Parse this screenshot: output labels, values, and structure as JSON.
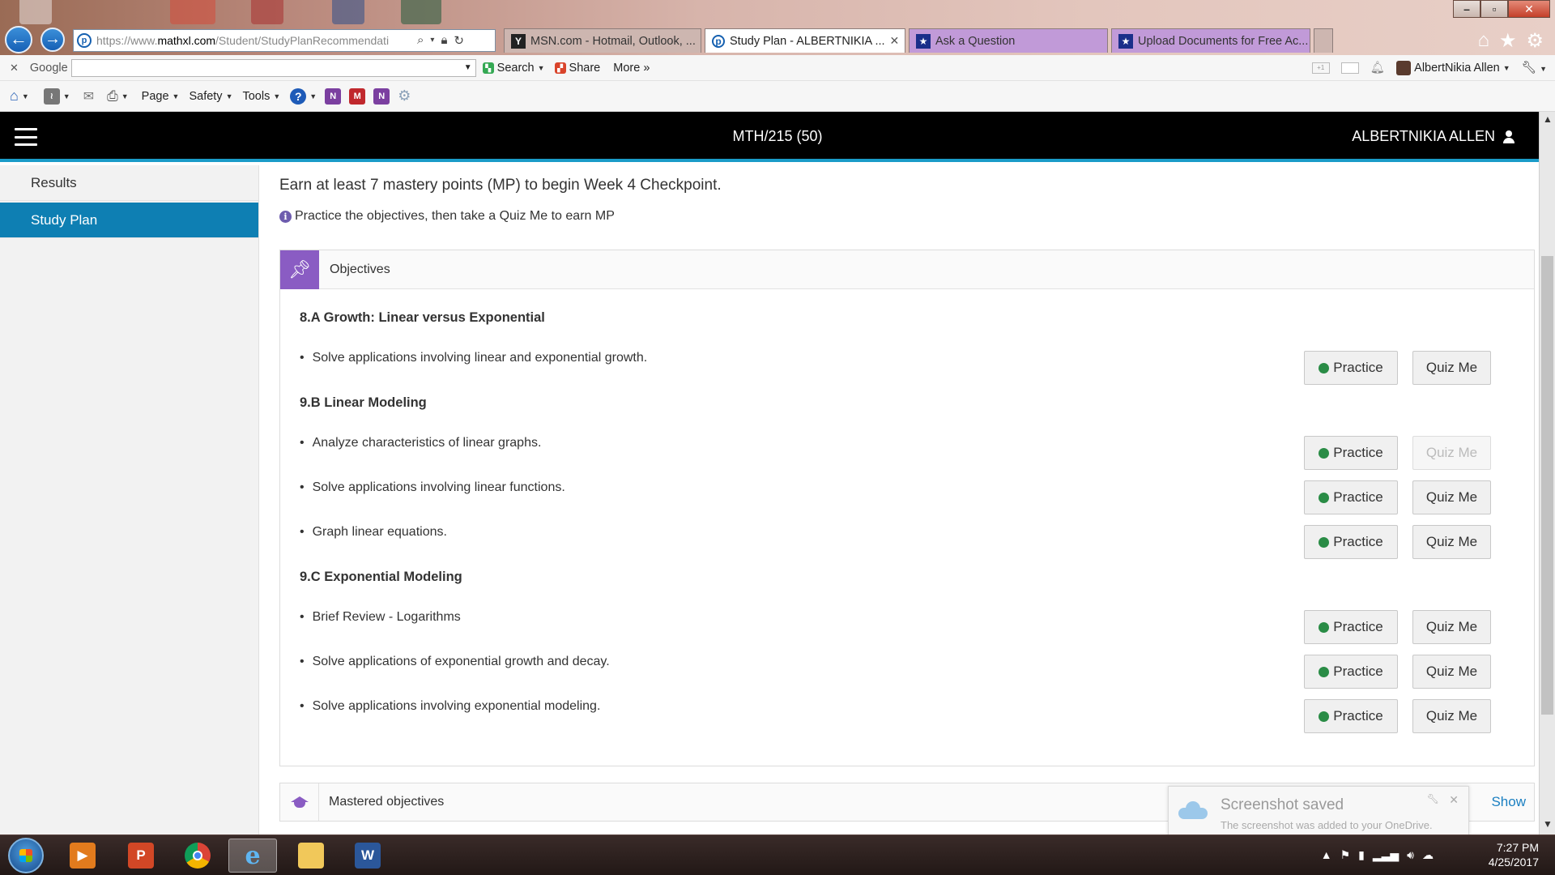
{
  "browser": {
    "url_prefix": "https://www.",
    "url_domain": "mathxl.com",
    "url_path": "/Student/StudyPlanRecommendati",
    "tabs": [
      {
        "label": "MSN.com - Hotmail, Outlook, ...",
        "active": false
      },
      {
        "label": "Study Plan - ALBERTNIKIA ...",
        "active": true
      },
      {
        "label": "Ask a Question",
        "active": false
      },
      {
        "label": "Upload Documents for Free Ac...",
        "active": false
      }
    ],
    "google_label": "Google",
    "search_label": "Search",
    "share_label": "Share",
    "more_label": "More »",
    "account_label": "AlbertNikia Allen",
    "command_bar": {
      "page": "Page",
      "safety": "Safety",
      "tools": "Tools"
    }
  },
  "header": {
    "course": "MTH/215 (50)",
    "user": "ALBERTNIKIA ALLEN"
  },
  "sidebar": {
    "items": [
      {
        "label": "Results",
        "active": false
      },
      {
        "label": "Study Plan",
        "active": true
      }
    ]
  },
  "main": {
    "instruction": "Earn at least 7 mastery points (MP) to begin Week 4 Checkpoint.",
    "hint": "Practice the objectives, then take a Quiz Me to earn MP",
    "objectives_title": "Objectives",
    "sections": [
      {
        "title": "8.A Growth: Linear versus Exponential",
        "objectives": [
          {
            "text": "Solve applications involving linear and exponential growth.",
            "practice": "Practice",
            "quiz": "Quiz Me",
            "quiz_enabled": true
          }
        ]
      },
      {
        "title": "9.B Linear Modeling",
        "objectives": [
          {
            "text": "Analyze characteristics of linear graphs.",
            "practice": "Practice",
            "quiz": "Quiz Me",
            "quiz_enabled": false
          },
          {
            "text": "Solve applications involving linear functions.",
            "practice": "Practice",
            "quiz": "Quiz Me",
            "quiz_enabled": true
          },
          {
            "text": "Graph linear equations.",
            "practice": "Practice",
            "quiz": "Quiz Me",
            "quiz_enabled": true
          }
        ]
      },
      {
        "title": "9.C Exponential Modeling",
        "objectives": [
          {
            "text": "Brief Review - Logarithms",
            "practice": "Practice",
            "quiz": "Quiz Me",
            "quiz_enabled": true
          },
          {
            "text": "Solve applications of exponential growth and decay.",
            "practice": "Practice",
            "quiz": "Quiz Me",
            "quiz_enabled": true
          },
          {
            "text": "Solve applications involving exponential modeling.",
            "practice": "Practice",
            "quiz": "Quiz Me",
            "quiz_enabled": true
          }
        ]
      }
    ],
    "mastered_title": "Mastered objectives",
    "show_label": "Show"
  },
  "toast": {
    "title": "Screenshot saved",
    "body": "The screenshot was added to your OneDrive."
  },
  "taskbar": {
    "time": "7:27 PM",
    "date": "4/25/2017"
  },
  "colors": {
    "header_bg": "#000000",
    "header_accent": "#1a9bc8",
    "sidebar_active": "#0e7fb3",
    "objectives_accent": "#8a5cc3",
    "practice_dot": "#2a8c46"
  }
}
